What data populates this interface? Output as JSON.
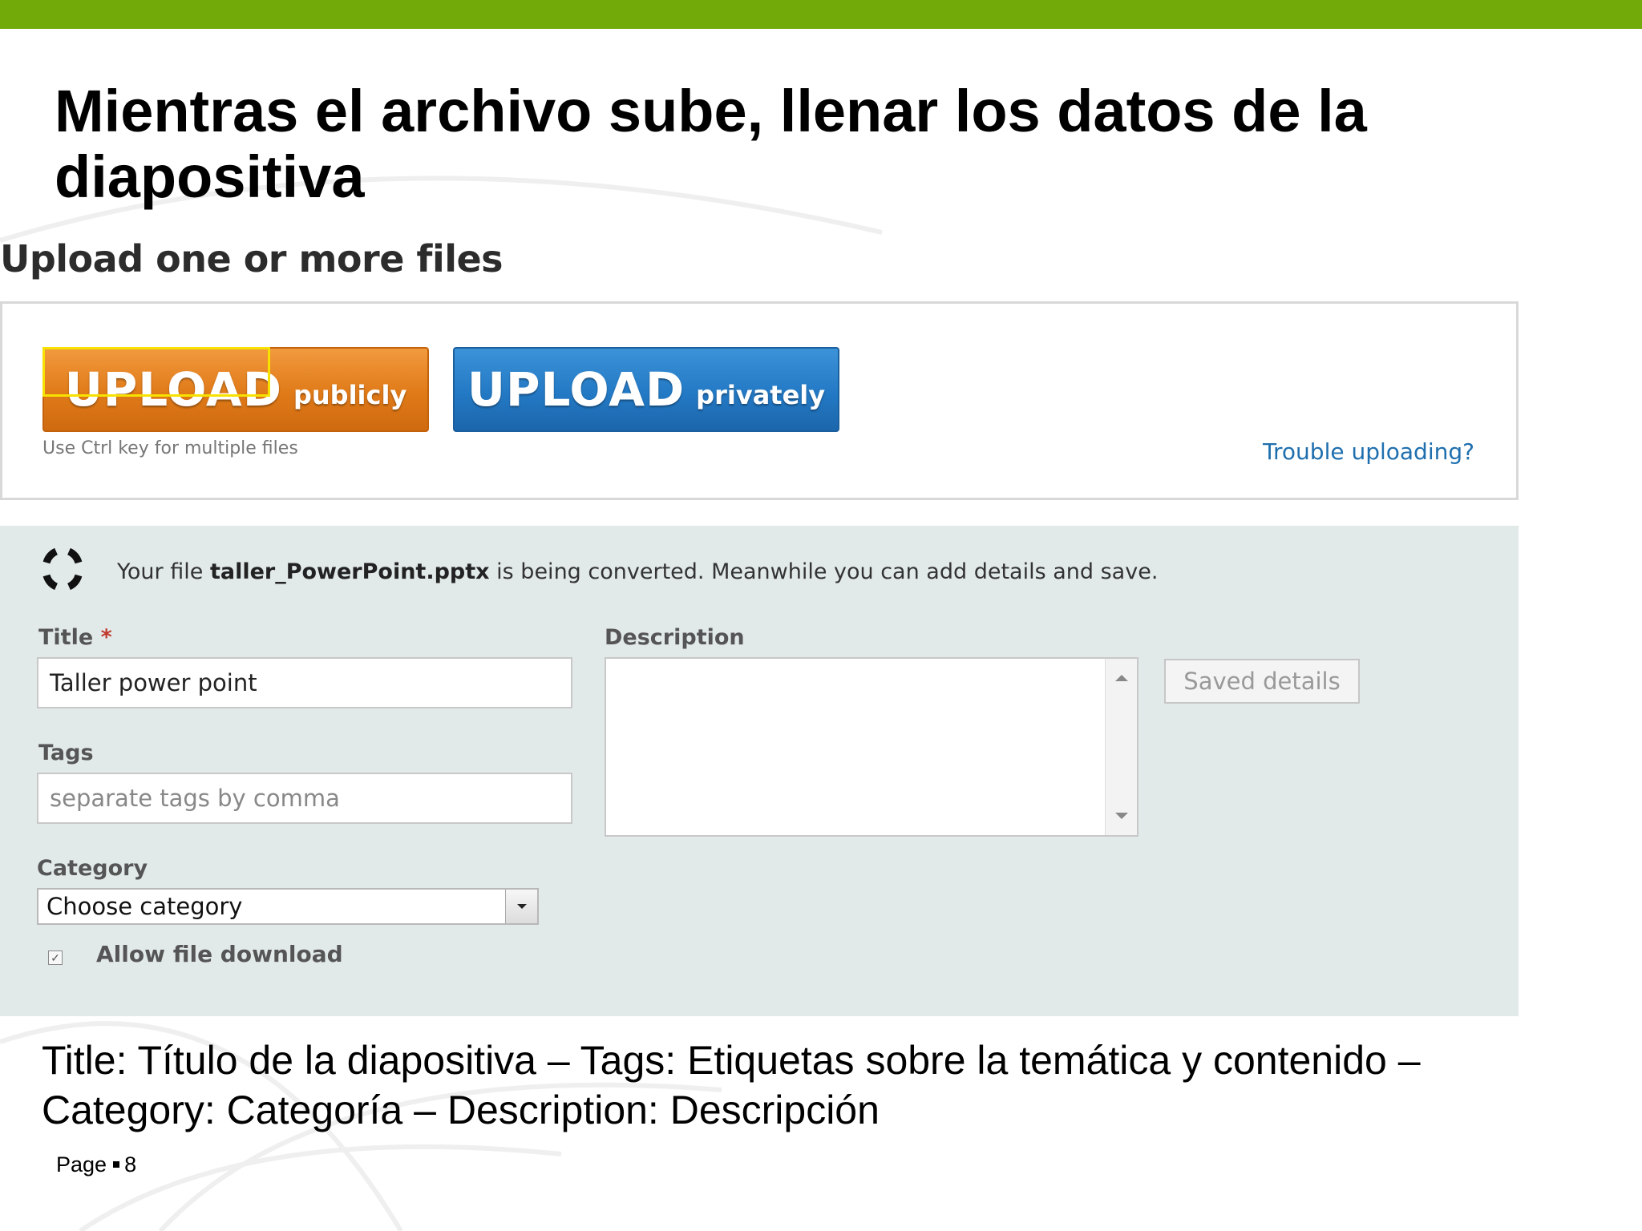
{
  "slide": {
    "title": "Mientras el archivo sube, llenar los datos de la diapositiva",
    "caption_line1": "Title: Título  de la diapositiva – Tags: Etiquetas sobre la temática y contenido –",
    "caption_line2": "Category: Categoría – Description: Descripción",
    "page_label": "Page",
    "page_number": "8",
    "accent_color": "#72aa0a"
  },
  "upload": {
    "heading": "Upload one or more files",
    "public_button": {
      "big": "UPLOAD",
      "small": "publicly",
      "color": "#e07a18"
    },
    "private_button": {
      "big": "UPLOAD",
      "small": "privately",
      "color": "#2379c4"
    },
    "hint": "Use Ctrl key for multiple files",
    "trouble_link": "Trouble uploading?"
  },
  "details": {
    "status_prefix": "Your file ",
    "file_name": "taller_PowerPoint.pptx",
    "status_suffix": " is being converted. Meanwhile you can add details and save.",
    "title_label": "Title",
    "required_mark": "*",
    "title_value": "Taller power point",
    "tags_label": "Tags",
    "tags_placeholder": "separate tags by comma",
    "category_label": "Category",
    "category_value": "Choose category",
    "description_label": "Description",
    "description_value": "",
    "saved_button": "Saved details",
    "allow_download_label": "Allow file download",
    "allow_download_checked": true
  }
}
